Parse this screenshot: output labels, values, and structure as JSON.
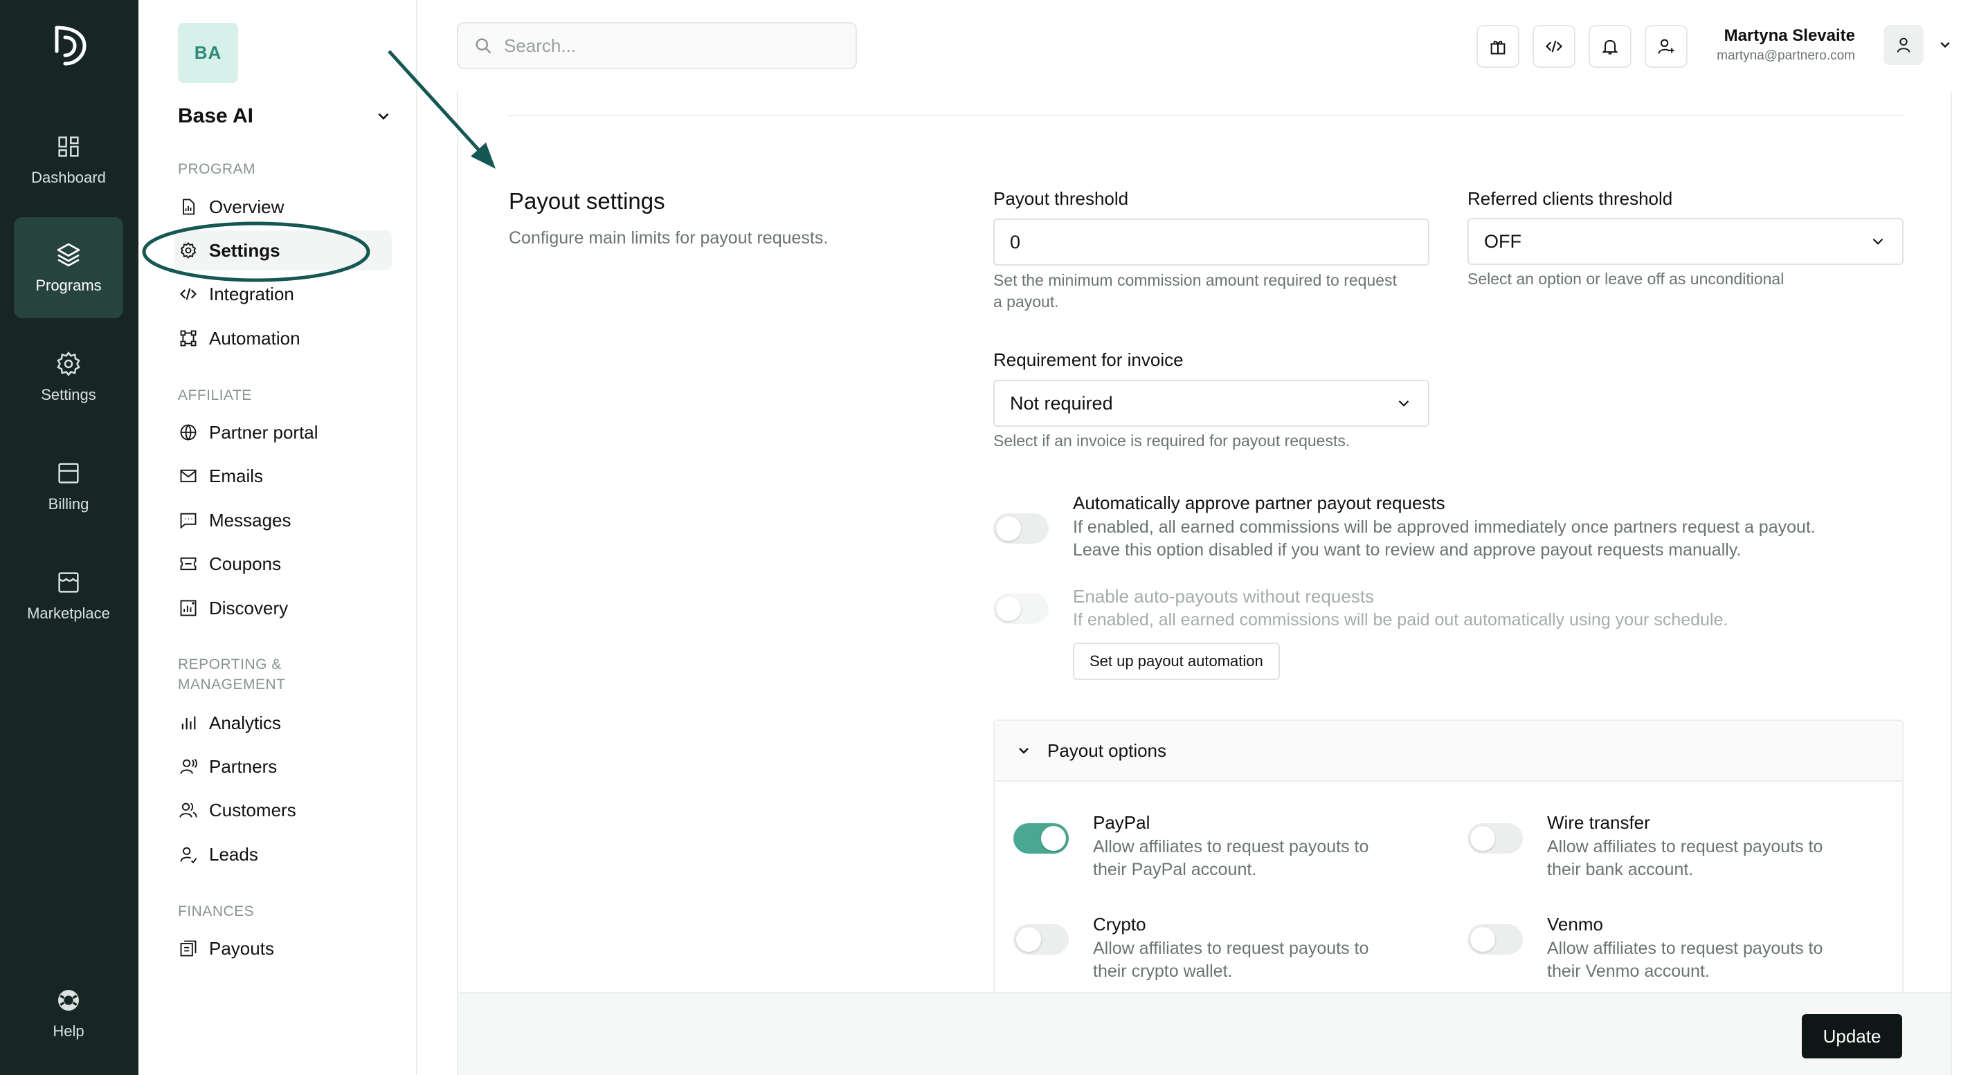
{
  "rail": {
    "items": [
      {
        "label": "Dashboard",
        "icon": "dashboard-icon"
      },
      {
        "label": "Programs",
        "icon": "layers-icon"
      },
      {
        "label": "Settings",
        "icon": "gear-icon"
      },
      {
        "label": "Billing",
        "icon": "billing-icon"
      },
      {
        "label": "Marketplace",
        "icon": "store-icon"
      }
    ],
    "help_label": "Help"
  },
  "sidebar": {
    "badge": "BA",
    "program_name": "Base AI",
    "sections": {
      "program": "PROGRAM",
      "affiliate": "AFFILIATE",
      "reporting_1": "REPORTING &",
      "reporting_2": "MANAGEMENT",
      "finances": "FINANCES"
    },
    "items": {
      "overview": "Overview",
      "settings": "Settings",
      "integration": "Integration",
      "automation": "Automation",
      "partner_portal": "Partner portal",
      "emails": "Emails",
      "messages": "Messages",
      "coupons": "Coupons",
      "discovery": "Discovery",
      "analytics": "Analytics",
      "partners": "Partners",
      "customers": "Customers",
      "leads": "Leads",
      "payouts": "Payouts"
    }
  },
  "topbar": {
    "search_placeholder": "Search...",
    "user_name": "Martyna Slevaite",
    "user_email": "martyna@partnero.com"
  },
  "payout_settings": {
    "title": "Payout settings",
    "subtitle": "Configure main limits for payout requests.",
    "threshold_label": "Payout threshold",
    "threshold_value": "0",
    "threshold_help_1": "Set the minimum commission amount required to request",
    "threshold_help_2": "a payout.",
    "clients_label": "Referred clients threshold",
    "clients_value": "OFF",
    "clients_help": "Select an option or leave off as unconditional",
    "invoice_label": "Requirement for invoice",
    "invoice_value": "Not required",
    "invoice_help": "Select if an invoice is required for payout requests.",
    "auto_approve_title": "Automatically approve partner payout requests",
    "auto_approve_desc_1": "If enabled, all earned commissions will be approved immediately once partners request a payout.",
    "auto_approve_desc_2": "Leave this option disabled if you want to review and approve payout requests manually.",
    "auto_payout_title": "Enable auto-payouts without requests",
    "auto_payout_desc": "If enabled, all earned commissions will be paid out automatically using your schedule.",
    "automation_button": "Set up payout automation"
  },
  "payout_options": {
    "title": "Payout options",
    "paypal_title": "PayPal",
    "paypal_desc_1": "Allow affiliates to request payouts to",
    "paypal_desc_2": "their PayPal account.",
    "wire_title": "Wire transfer",
    "wire_desc_1": "Allow affiliates to request payouts to",
    "wire_desc_2": "their bank account.",
    "crypto_title": "Crypto",
    "crypto_desc_1": "Allow affiliates to request payouts to",
    "crypto_desc_2": "their crypto wallet.",
    "venmo_title": "Venmo",
    "venmo_desc_1": "Allow affiliates to request payouts to",
    "venmo_desc_2": "their Venmo account."
  },
  "footer": {
    "update_label": "Update"
  },
  "colors": {
    "rail_bg": "#172624",
    "accent": "#4aa892",
    "annotation": "#155752"
  }
}
